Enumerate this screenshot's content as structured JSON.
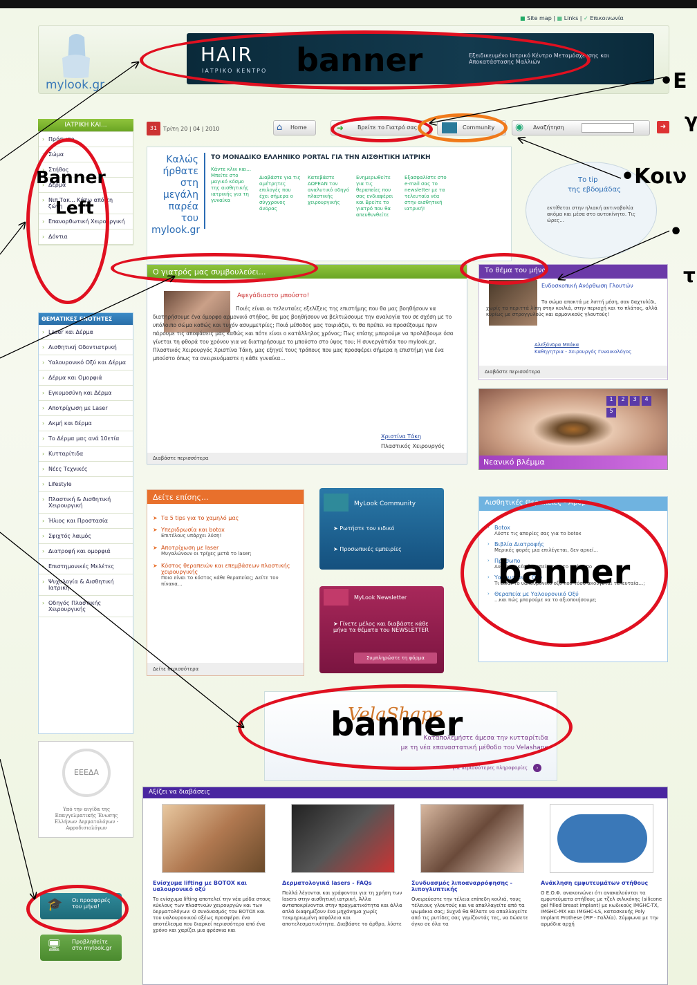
{
  "top_links": {
    "sitemap": "Site map",
    "links": "Links",
    "contact": "Επικοινωνία"
  },
  "logo": {
    "text": "mylook.gr"
  },
  "hair_banner": {
    "brand": "HAIR",
    "sub": "ΙΑΤΡΙΚΟ ΚΕΝΤΡΟ",
    "desc": "Εξειδικευμένο Ιατρικό Κέντρο Μεταμόσχευσης και Αποκατάστασης Μαλλιών"
  },
  "annotations": {
    "banner": "banner",
    "banner_left1": "Banner",
    "banner_left2": "Left",
    "right_e": "•Ε",
    "right_g": "γ",
    "right_koin": "•Κοιν",
    "right_dot": "•",
    "right_t": "τ"
  },
  "date": "Τρίτη 20 | 04 | 2010",
  "nav": {
    "home": "Home",
    "find_doctor": "Βρείτε το Γιατρό σας",
    "community": "Community",
    "search": "Αναζήτηση"
  },
  "left_menu": {
    "title": "ΙΑΤΡΙΚΗ ΚΑΙ...",
    "items": [
      "Πρόσωπο",
      "Σώμα",
      "Στήθος",
      "Δέρμα",
      "Νιπ Τακ... Κάτω από τη ζώνη",
      "Επανορθωτική Χειρουργική",
      "Δόντια"
    ]
  },
  "thematic": {
    "title": "ΘΕΜΑΤΙΚΕΣ ΕΝΟΤΗΤΕΣ",
    "items": [
      "Laser και Δέρμα",
      "Αισθητική Οδοντιατρική",
      "Υαλουρονικό Οξύ και Δέρμα",
      "Δέρμα και Ομορφιά",
      "Εγκυμοσύνη και Δέρμα",
      "Αποτρίχωση με Laser",
      "Ακμή και δέρμα",
      "Το Δέρμα μας ανά 10ετία",
      "Κυτταρίτιδα",
      "Νέες Τεχνικές",
      "Lifestyle",
      "Πλαστική & Αισθητική Χειρουργική",
      "Ήλιος και Προστασία",
      "Σφιχτός λαιμός",
      "Διατροφή και ομορφιά",
      "Επιστημονικές Μελέτες",
      "Ψυχολογία & Αισθητική Ιατρική",
      "Οδηγός Πλαστικής Χειρουργικής"
    ]
  },
  "eede": {
    "logo": "EEEΔA",
    "text": "Υπό την αιγίδα της Επαγγελματικής Ένωσης Ελλήνων Δερματολόγων - Αφροδισιολόγων"
  },
  "offers_btn": "Οι προσφορές του μήνα!",
  "preview_btn": "Προβληθείτε στο mylook.gr",
  "welcome": {
    "w1": "Καλώς",
    "w2": "ήρθατε",
    "w3": "στη",
    "w4": "μεγάλη",
    "w5": "παρέα",
    "w6": "του",
    "w7": "mylook.gr",
    "portal": "ΤΟ ΜΟΝΑΔΙΚΟ ΕΛΛΗΝΙΚΟ PORTAL ΓΙΑ ΤΗΝ ΑΙΣΘΗΤΙΚΗ ΙΑΤΡΙΚΗ",
    "cols": [
      "Κάντε κλικ και... Μπείτε στο μαγικό κόσμο της αισθητικής ιατρικής για τη γυναίκα",
      "Διαβάστε για τις αμέτρητες επιλογές που έχει σήμερα ο σύγχρονος άνδρας",
      "Κατεβάστε ΔΩΡΕΑΝ τον αναλυτικό οδηγό πλαστικής χειρουργικής",
      "Ενημερωθείτε για τις θεραπείες που σας ενδιαφέρει και Βρείτε το γιατρό που θα απευθυνθείτε",
      "Εξασφαλίστε στο e-mail σας το newsletter με τα τελευταία νέα στην αισθητική ιατρική!"
    ]
  },
  "tip": {
    "title1": "Το tip",
    "title2": "της εβδομάδας",
    "text": "εκτίθεται στην ηλιακή ακτινοβολία ακόμα και μέσα στο αυτοκίνητο. Τις ώρες..."
  },
  "doctor": {
    "header": "Ο γιατρός μας συμβουλεύει...",
    "title": "Αψεγάδιαστο μπούστο!",
    "body": "Ποιές είναι οι τελευταίες εξελίξεις της επιστήμης που θα μας βοηθήσουν να διατηρήσουμε ένα όμορφο αρμονικό στήθος, θα μας βοηθήσουν να βελτιώσουμε την αναλογία του σε σχέση με το υπόλοιπο σώμα καθώς και τυχόν ασυμμετρίες; Ποιά μέθοδος μας ταιριάζει, τι θα πρέπει να προσέξουμε πριν πάρουμε τις αποφάσεις μας καθώς και πότε είναι ο κατάλληλος χρόνος; Πως επίσης μπορούμε να προλάβουμε όσα γίνεται τη φθορά του χρόνου για να διατηρήσουμε το μπούστο στο ύψος του; Η συνεργάτιδα του mylook.gr, Πλαστικός Χειρουργός Χριστίνα Τάκη, μας εξηγεί τους τρόπους που μας προσφέρει σήμερα η επιστήμη για ένα μπούστο όπως τα ονειρευόμαστε η κάθε γυναίκα...",
    "author": "Χριστίνα Τάκη",
    "role": "Πλαστικός Χειρουργός",
    "more": "Διαβάστε περισσότερα"
  },
  "month": {
    "header": "Το θέμα του μήνα",
    "title": "Ενδοσκοπική Ανόρθωση Γλουτών",
    "body": "Το σώμα αποκτά με λιπτή μέση, σαν δαχτυλίδι, χωρίς τα περιττά λίπη στην κοιλιά, στην περιοχή και το πλάτος, αλλά κυρίως με στρογγυλούς και αρμονικούς γλουτούς!",
    "author": "Αλεξάνδρα Μπάκα",
    "role": "Καθηγητρια - Χειρουργός Γυναικολόγος",
    "more": "Διαβάστε περισσότερα"
  },
  "eye": {
    "caption": "Νεανικό βλέμμα",
    "pages": [
      "1",
      "2",
      "3",
      "4",
      "5"
    ]
  },
  "see_also": {
    "header": "Δείτε επίσης...",
    "items": [
      {
        "t": "Τα 5 tips για το χαμηλό μας",
        "s": ""
      },
      {
        "t": "Υπεριδρωσία και botox",
        "s": "Επιτέλους υπάρχει λύση!"
      },
      {
        "t": "Αποτρίχωση με laser",
        "s": "Μυγαλώνουν οι τρίχες μετά το laser;"
      },
      {
        "t": "Κόστος θεραπειών και επεμβάσεων πλαστικής χειρουργικής",
        "s": "Ποιο είναι το κόστος κάθε θεραπείας; Δείτε τον πίνακα..."
      }
    ],
    "more": "Δείτε περισσότερα"
  },
  "community": {
    "header": "MyLook Community",
    "items": [
      "Ρωτήστε τον ειδικό",
      "Προσωπικές εμπειρίες"
    ]
  },
  "newsletter": {
    "header": "MyLook Newsletter",
    "text": "Γίνετε μέλος και διαβάστε κάθε μήνα τα θέματα του NEWSLETTER",
    "btn": "Συμπληρώστε τη φόρμα"
  },
  "therapies": {
    "header": "Αισθητικές Θεραπείες - Άρθρα",
    "items": [
      {
        "t": "Botox",
        "s": "Λύστε τις απορίες σας για το botox"
      },
      {
        "t": "Βιβλία Διατροφής",
        "s": "Μερικές φορές μια επιλέγεται, δεν αρκεί..."
      },
      {
        "t": "Πρόσωπο",
        "s": "Ανανεωτικές θεραπείες για το πρόσωπο"
      },
      {
        "t": "Υαλουρονικό Οξύ",
        "s": "Τι είναι το υαλουρονικό οξύ που τόσο ακούγεται τελευταία...;"
      },
      {
        "t": "Θεραπεία με Υαλουρονικό Οξύ",
        "s": "...και πώς μπορούμε να το αξιοποιήσουμε;"
      }
    ]
  },
  "velashape": {
    "logo": "VelaShape",
    "text1": "Καταπολεμήστε άμεσα την κυτταρίτιδα",
    "text2": "με τη νέα επαναστατική μέθοδο του Velashape",
    "more": "για περισσότερες πληροφορίες"
  },
  "worth": {
    "header": "Αξίζει να διαβάσεις",
    "articles": [
      {
        "t": "Ενίσχυμα lifting με BOTOX και υαλουρονικό οξύ",
        "b": "Το ενίσχυμα lifting αποτελεί την νέα μόδα στους κύκλους των πλαστικών χειρουργών και των δερματολόγων: Ο συνδυασμός του BOTOX και του υαλουρονικού οξέως προσφέρει ένα αποτέλεσμα που διαρκεί περισσότερο από ένα χρόνο και χαρίζει μια φρέσκια και"
      },
      {
        "t": "Δερματολογικά lasers - FAQs",
        "b": "Πολλά λέγονται και γράφονται για τη χρήση των lasers στην αισθητική ιατρική. Άλλα ανταποκρίνονται στην πραγματικότητα και άλλα απλά διαφημίζουν ένα μηχάνημα χωρίς τεκμηριωμένη ασφάλεια και αποτελεσματικότητα. Διαβάστε το άρθρο, λύστε"
      },
      {
        "t": "Συνδυασμός λιποαναρρόφησης - λιπογλυπτικής",
        "b": "Ονειρεύεστε την τέλεια επίπεδη κοιλιά, τους τέλειους γλουτούς και να απαλλαγείτε από τα ψωμάκια σας; Συχνά θα θέλατε να απαλλαγείτε από τις ρυτίδες σας γεμίζοντάς τες, να δώσετε όγκο σε όλα τα"
      },
      {
        "t": "Ανάκληση εμφυτευμάτων στήθους",
        "b": "Ο Ε.Ο.Φ. ανακοινώνει ότι ανακαλούνται τα εμφυτεύματα στήθους με τζελ σιλικόνης (silicone gel filled breast implant) με κωδικούς IMGHC-TX, IMGHC-MX και IMGHC-LS, κατασκευής Poly Implant Prothese (PIP - Γαλλία). Σύμφωνα με την αρμόδια αρχή"
      }
    ]
  }
}
